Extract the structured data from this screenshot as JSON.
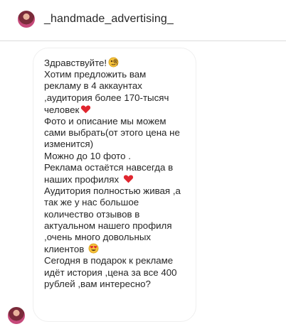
{
  "header": {
    "username": "_handmade_advertising_",
    "avatar_icon": "profile-avatar"
  },
  "message": {
    "lines": [
      "Здравствуйте!",
      "Хотим предложить вам",
      "рекламу в 4 аккаунтах",
      ",аудитория более 170-тысяч",
      "человек",
      "Фото и описание мы можем",
      "сами выбрать(от этого цена не",
      "изменится)",
      "Можно до 10 фото .",
      "Реклама остаётся навсегда в",
      "наших профилях",
      "Аудитория полностью живая ,а",
      "так же у нас большое",
      "количество отзывов в",
      "актуальном нашего профиля",
      ",очень много довольных",
      "клиентов",
      "Сегодня в подарок к рекламе",
      "идёт история ,цена за все 400",
      "рублей ,вам интересно?"
    ],
    "emoji_icons": [
      "face-with-monocle-icon",
      "red-heart-icon",
      "red-heart-icon",
      "heart-eyes-icon"
    ]
  },
  "colors": {
    "text": "#262626",
    "heart": "#e0262f",
    "bubble_border": "#efefef",
    "divider": "#dbdbdb"
  }
}
